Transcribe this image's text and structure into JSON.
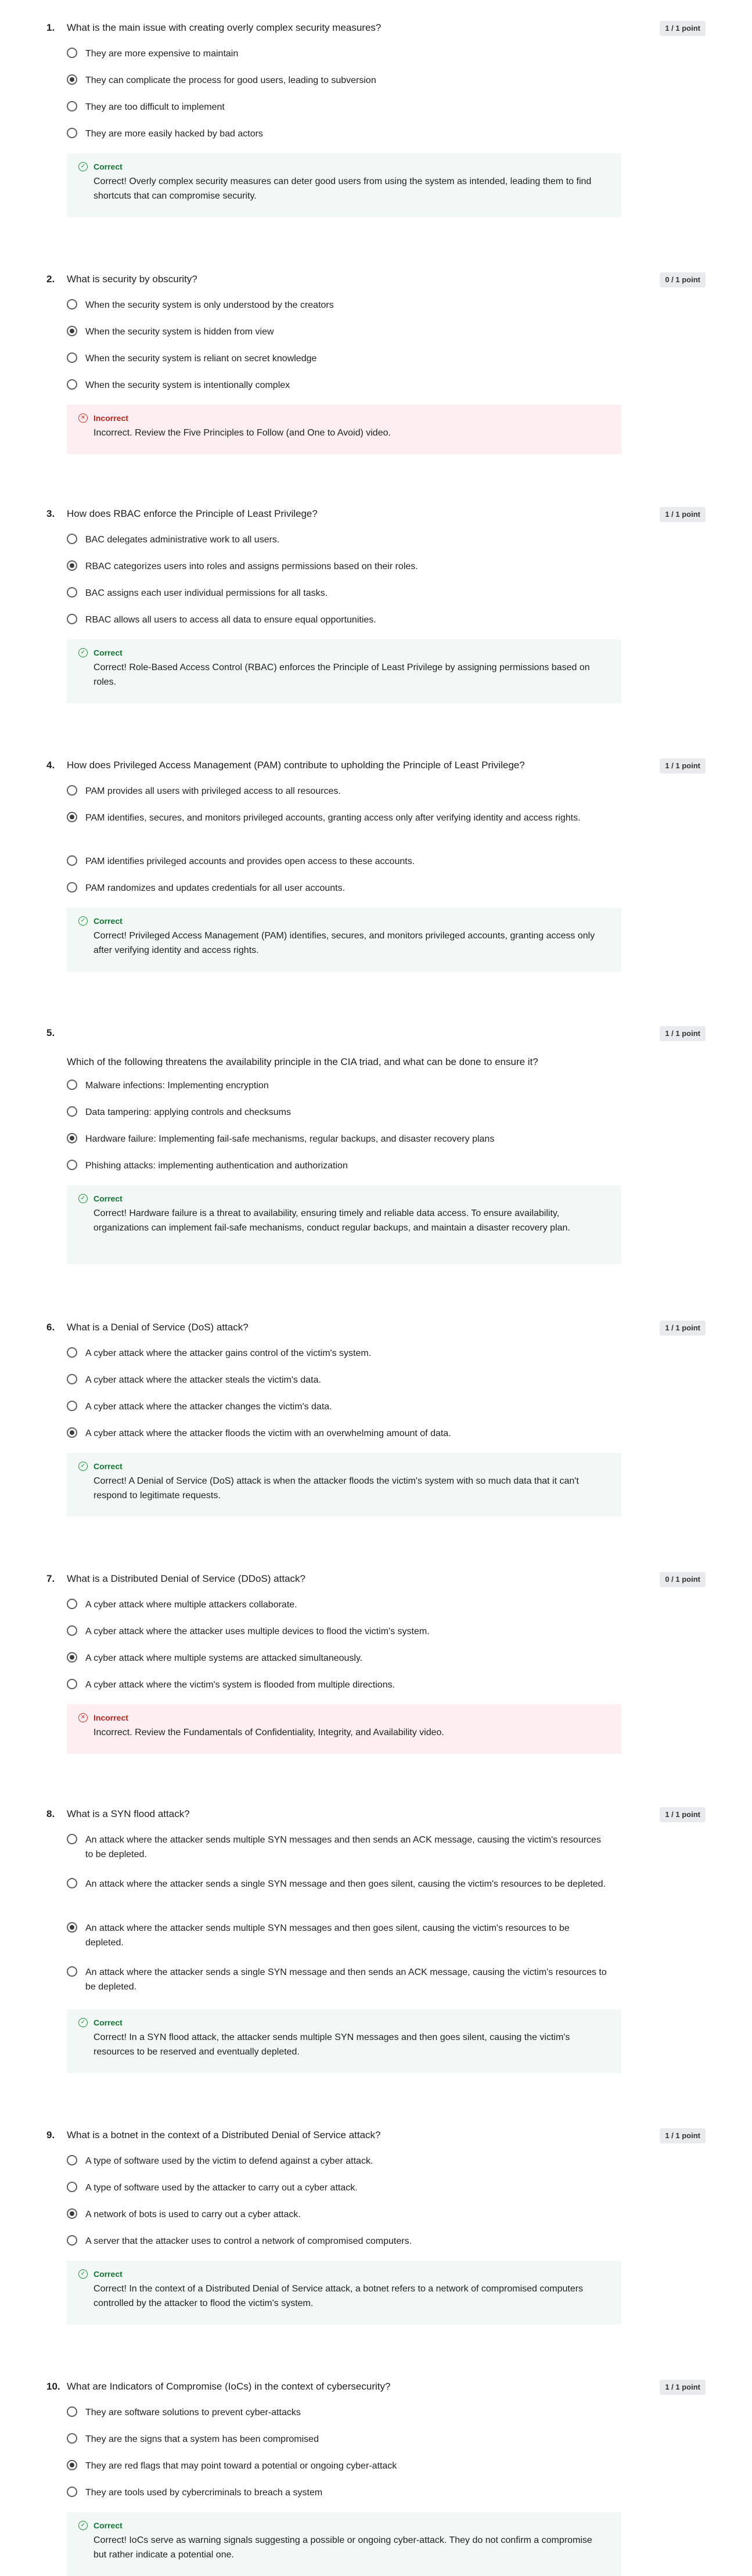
{
  "questions": [
    {
      "number": "1.",
      "text": "What is the main issue with creating overly complex security measures?",
      "points": "1 / 1 point",
      "options": [
        {
          "label": "They are more expensive to maintain",
          "selected": false
        },
        {
          "label": "They can complicate the process for good users, leading to subversion",
          "selected": true
        },
        {
          "label": "They are too difficult to implement",
          "selected": false
        },
        {
          "label": "They are more easily hacked by bad actors",
          "selected": false
        }
      ],
      "feedback": {
        "status": "Correct",
        "correct": true,
        "text": "Correct! Overly complex security measures can deter good users from using the system as intended, leading them to find shortcuts that can compromise security."
      }
    },
    {
      "number": "2.",
      "text": "What is security by obscurity?",
      "points": "0 / 1 point",
      "options": [
        {
          "label": "When the security system is only understood by the creators",
          "selected": false
        },
        {
          "label": "When the security system is hidden from view",
          "selected": true
        },
        {
          "label": "When the security system is reliant on secret knowledge",
          "selected": false
        },
        {
          "label": "When the security system is intentionally complex",
          "selected": false
        }
      ],
      "feedback": {
        "status": "Incorrect",
        "correct": false,
        "text": "Incorrect. Review the Five Principles to Follow (and One to Avoid) video."
      }
    },
    {
      "number": "3.",
      "text": "How does RBAC enforce the Principle of Least Privilege?",
      "points": "1 / 1 point",
      "options": [
        {
          "label": "BAC delegates administrative work to all users.",
          "selected": false
        },
        {
          "label": "RBAC categorizes users into roles and assigns permissions based on their roles.",
          "selected": true
        },
        {
          "label": "BAC assigns each user individual permissions for all tasks.",
          "selected": false
        },
        {
          "label": "RBAC allows all users to access all data to ensure equal opportunities.",
          "selected": false
        }
      ],
      "feedback": {
        "status": "Correct",
        "correct": true,
        "text": "Correct! Role-Based Access Control (RBAC) enforces the Principle of Least Privilege by assigning permissions based on roles."
      }
    },
    {
      "number": "4.",
      "text": "How does Privileged Access Management (PAM) contribute to upholding the Principle of Least Privilege?",
      "points": "1 / 1 point",
      "options": [
        {
          "label": "PAM provides all users with privileged access to all resources.",
          "selected": false
        },
        {
          "label": "PAM identifies, secures, and monitors privileged accounts, granting access only after verifying identity and access rights.",
          "selected": true
        },
        {
          "label": "PAM identifies privileged accounts and provides open access to these accounts.",
          "selected": false
        },
        {
          "label": "PAM randomizes and updates credentials for all user accounts.",
          "selected": false
        }
      ],
      "feedback": {
        "status": "Correct",
        "correct": true,
        "text": "Correct! Privileged Access Management (PAM) identifies, secures, and monitors privileged accounts, granting access only after verifying identity and access rights."
      }
    },
    {
      "number": "5.",
      "text": "Which of the following threatens the availability principle in the CIA triad, and what can be done to ensure it?",
      "points": "1 / 1 point",
      "options": [
        {
          "label": "Malware infections: Implementing encryption",
          "selected": false
        },
        {
          "label": "Data tampering: applying controls and checksums",
          "selected": false
        },
        {
          "label": "Hardware failure: Implementing fail-safe mechanisms, regular backups, and disaster recovery plans",
          "selected": true
        },
        {
          "label": "Phishing attacks: implementing authentication and authorization",
          "selected": false
        }
      ],
      "feedback": {
        "status": "Correct",
        "correct": true,
        "text": "Correct! Hardware failure is a threat to availability, ensuring timely and reliable data access. To ensure availability, organizations can implement fail-safe mechanisms, conduct regular backups, and maintain a disaster recovery plan."
      }
    },
    {
      "number": "6.",
      "text": "What is a Denial of Service (DoS) attack?",
      "points": "1 / 1 point",
      "options": [
        {
          "label": "A cyber attack where the attacker gains control of the victim's system.",
          "selected": false
        },
        {
          "label": "A cyber attack where the attacker steals the victim's data.",
          "selected": false
        },
        {
          "label": "A cyber attack where the attacker changes the victim's data.",
          "selected": false
        },
        {
          "label": "A cyber attack where the attacker floods the victim with an overwhelming amount of data.",
          "selected": true
        }
      ],
      "feedback": {
        "status": "Correct",
        "correct": true,
        "text": "Correct! A Denial of Service (DoS) attack is when the attacker floods the victim's system with so much data that it can't respond to legitimate requests."
      }
    },
    {
      "number": "7.",
      "text": "What is a Distributed Denial of Service (DDoS) attack?",
      "points": "0 / 1 point",
      "options": [
        {
          "label": "A cyber attack where multiple attackers collaborate.",
          "selected": false
        },
        {
          "label": "A cyber attack where the attacker uses multiple devices to flood the victim's system.",
          "selected": false
        },
        {
          "label": "A cyber attack where multiple systems are attacked simultaneously.",
          "selected": true
        },
        {
          "label": "A cyber attack where the victim's system is flooded from multiple directions.",
          "selected": false
        }
      ],
      "feedback": {
        "status": "Incorrect",
        "correct": false,
        "text": "Incorrect. Review the Fundamentals of Confidentiality, Integrity, and Availability video."
      }
    },
    {
      "number": "8.",
      "text": "What is a SYN flood attack?",
      "points": "1 / 1 point",
      "options": [
        {
          "label": "An attack where the attacker sends multiple SYN messages and then sends an ACK message, causing the victim's resources to be depleted.",
          "selected": false
        },
        {
          "label": "An attack where the attacker sends a single SYN message and then goes silent, causing the victim's resources to be depleted.",
          "selected": false
        },
        {
          "label": "An attack where the attacker sends multiple SYN messages and then goes silent, causing the victim's resources to be depleted.",
          "selected": true
        },
        {
          "label": "An attack where the attacker sends a single SYN message and then sends an ACK message, causing the victim's resources to be depleted.",
          "selected": false
        }
      ],
      "feedback": {
        "status": "Correct",
        "correct": true,
        "text": "Correct! In a SYN flood attack, the attacker sends multiple SYN messages and then goes silent, causing the victim's resources to be reserved and eventually depleted."
      }
    },
    {
      "number": "9.",
      "text": "What is a botnet in the context of a Distributed Denial of Service attack?",
      "points": "1 / 1 point",
      "options": [
        {
          "label": "A type of software used by the victim to defend against a cyber attack.",
          "selected": false
        },
        {
          "label": "A type of software used by the attacker to carry out a cyber attack.",
          "selected": false
        },
        {
          "label": "A network of bots is used to carry out a cyber attack.",
          "selected": true
        },
        {
          "label": "A server that the attacker uses to control a network of compromised computers.",
          "selected": false
        }
      ],
      "feedback": {
        "status": "Correct",
        "correct": true,
        "text": "Correct! In the context of a Distributed Denial of Service attack, a botnet refers to a network of compromised computers controlled by the attacker to flood the victim's system."
      }
    },
    {
      "number": "10.",
      "text": "What are Indicators of Compromise (IoCs) in the context of cybersecurity?",
      "points": "1 / 1 point",
      "options": [
        {
          "label": "They are software solutions to prevent cyber-attacks",
          "selected": false
        },
        {
          "label": "They are the signs that a system has been compromised",
          "selected": false
        },
        {
          "label": "They are red flags that may point toward a potential or ongoing cyber-attack",
          "selected": true
        },
        {
          "label": "They are tools used by cybercriminals to breach a system",
          "selected": false
        }
      ],
      "feedback": {
        "status": "Correct",
        "correct": true,
        "text": "Correct! IoCs serve as warning signals suggesting a possible or ongoing cyber-attack. They do not confirm a compromise but rather indicate a potential one."
      }
    }
  ]
}
